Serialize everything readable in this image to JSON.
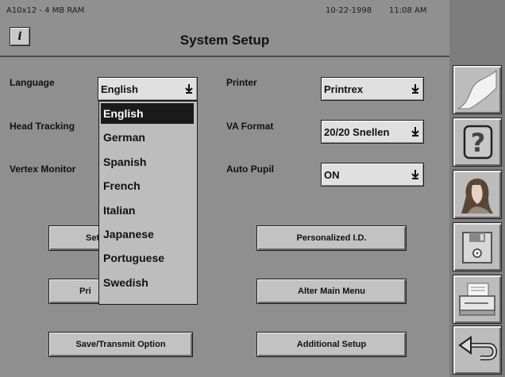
{
  "status": {
    "memory": "A10x12 - 4 MB RAM",
    "date": "10-22-1998",
    "time": "11:08 AM"
  },
  "header": {
    "title": "System Setup",
    "info_icon": "i"
  },
  "fields": {
    "language": {
      "label": "Language",
      "value": "English"
    },
    "head_tracking": {
      "label": "Head Tracking"
    },
    "vertex_monitor": {
      "label": "Vertex Monitor"
    },
    "printer": {
      "label": "Printer",
      "value": "Printrex"
    },
    "va_format": {
      "label": "VA Format",
      "value": "20/20 Snellen"
    },
    "auto_pupil": {
      "label": "Auto Pupil",
      "value": "ON"
    }
  },
  "language_options": [
    "English",
    "German",
    "Spanish",
    "French",
    "Italian",
    "Japanese",
    "Portuguese",
    "Swedish"
  ],
  "language_selected_index": 0,
  "buttons": {
    "set_partial": "Set T",
    "print_partial": "Pri",
    "save_transmit": "Save/Transmit Option",
    "personalized_id": "Personalized I.D.",
    "alter_main_menu": "Alter Main Menu",
    "additional_setup": "Additional Setup"
  },
  "sidebar_icons": [
    "lens-icon",
    "help-icon",
    "patient-icon",
    "floppy-disk-icon",
    "printer-icon",
    "return-arrow-icon"
  ]
}
